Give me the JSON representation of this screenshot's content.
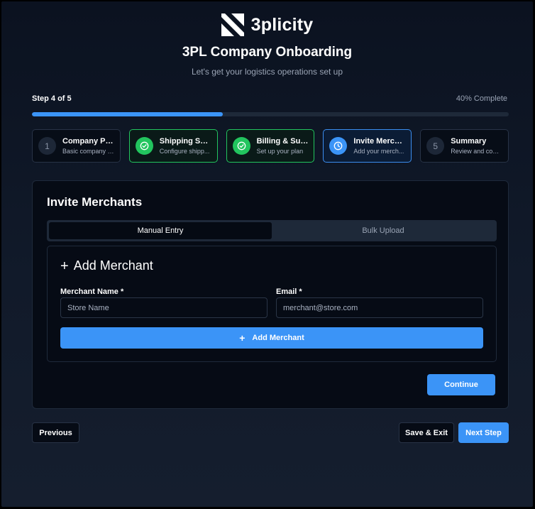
{
  "brand": {
    "name": "3plicity",
    "logo_icon": "3plicity-logo-icon"
  },
  "header": {
    "title": "3PL Company Onboarding",
    "subtitle": "Let's get your logistics operations set up"
  },
  "progress": {
    "step_label": "Step 4 of 5",
    "percent_label": "40% Complete",
    "fraction": 0.4
  },
  "steps": [
    {
      "number": "1",
      "title": "Company Pr...",
      "subtitle": "Basic company i...",
      "status": "pending",
      "icon": "number"
    },
    {
      "number": "2",
      "title": "Shipping Set...",
      "subtitle": "Configure shipp...",
      "status": "complete",
      "icon": "check-circle-icon"
    },
    {
      "number": "3",
      "title": "Billing & Sub...",
      "subtitle": "Set up your plan",
      "status": "complete",
      "icon": "check-circle-icon"
    },
    {
      "number": "4",
      "title": "Invite Merch...",
      "subtitle": "Add your merch...",
      "status": "active",
      "icon": "clock-icon"
    },
    {
      "number": "5",
      "title": "Summary",
      "subtitle": "Review and conf...",
      "status": "pending",
      "icon": "number"
    }
  ],
  "card": {
    "title": "Invite Merchants",
    "tabs": [
      {
        "label": "Manual Entry",
        "active": true
      },
      {
        "label": "Bulk Upload",
        "active": false
      }
    ],
    "form": {
      "title": "Add Merchant",
      "plus_icon": "+",
      "name_label": "Merchant Name *",
      "name_placeholder": "Store Name",
      "email_label": "Email *",
      "email_placeholder": "merchant@store.com",
      "add_button": "Add Merchant"
    },
    "continue_button": "Continue"
  },
  "footer": {
    "previous": "Previous",
    "save_exit": "Save & Exit",
    "next": "Next Step"
  },
  "colors": {
    "accent": "#3b94f7",
    "success": "#22c55e",
    "background": "#0b1220"
  }
}
